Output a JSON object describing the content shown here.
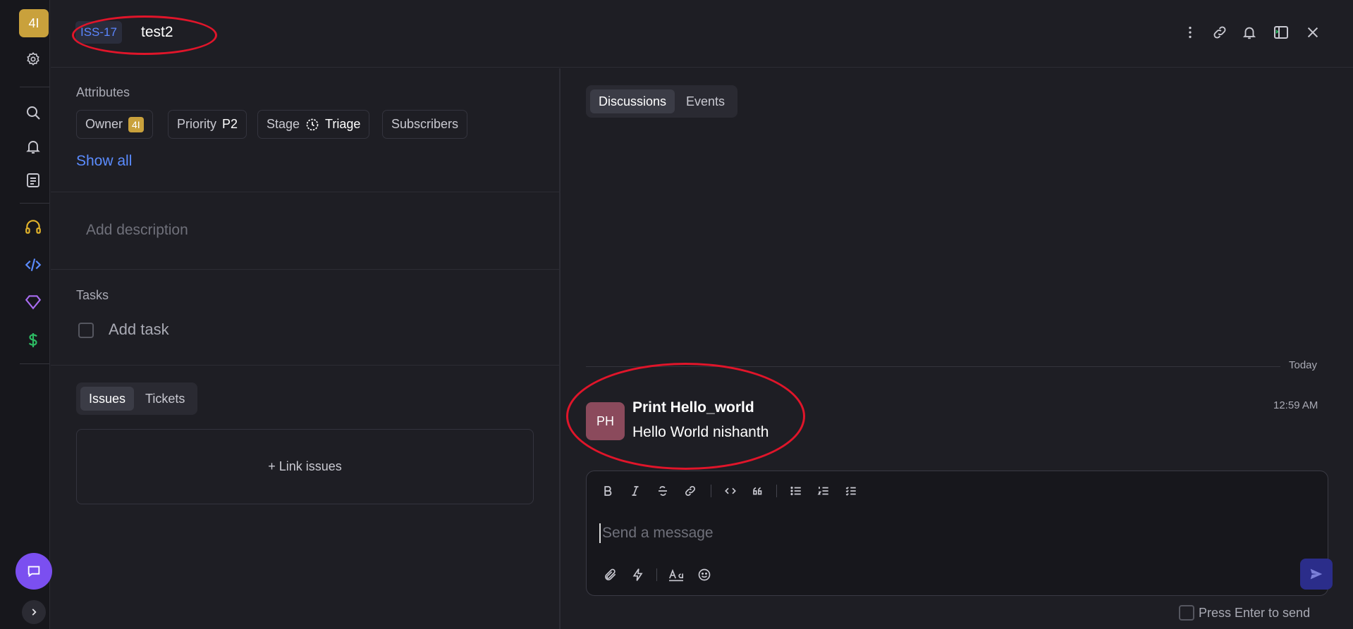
{
  "rail": {
    "workspace_label": "4I",
    "items": [
      "settings-icon",
      "search-icon",
      "bell-icon",
      "notes-icon",
      "headphones-icon",
      "code-icon",
      "gem-icon",
      "dollar-icon"
    ],
    "colors": {
      "headphones": "#e2b32b",
      "code": "#5b8cff",
      "gem": "#a86cf0",
      "dollar": "#2dbb63"
    }
  },
  "header": {
    "issue_id": "ISS-17",
    "title": "test2",
    "actions": [
      "more-icon",
      "link-icon",
      "bell-icon",
      "panel-icon",
      "close-icon"
    ]
  },
  "attributes": {
    "heading": "Attributes",
    "owner_label": "Owner",
    "owner_value": "4I",
    "priority_label": "Priority",
    "priority_value": "P2",
    "stage_label": "Stage",
    "stage_value": "Triage",
    "subscribers_label": "Subscribers",
    "show_all": "Show all"
  },
  "description": {
    "placeholder": "Add description"
  },
  "tasks": {
    "heading": "Tasks",
    "add_task": "Add task"
  },
  "links": {
    "tabs": [
      "Issues",
      "Tickets"
    ],
    "active_tab": "Issues",
    "link_issues": "+ Link issues"
  },
  "discussion": {
    "tabs": [
      "Discussions",
      "Events"
    ],
    "active_tab": "Discussions",
    "date_divider": "Today",
    "message": {
      "avatar": "PH",
      "author": "Print Hello_world",
      "body": "Hello World nishanth",
      "time": "12:59 AM"
    },
    "composer": {
      "placeholder": "Send a message",
      "press_enter": "Press Enter to send"
    }
  }
}
